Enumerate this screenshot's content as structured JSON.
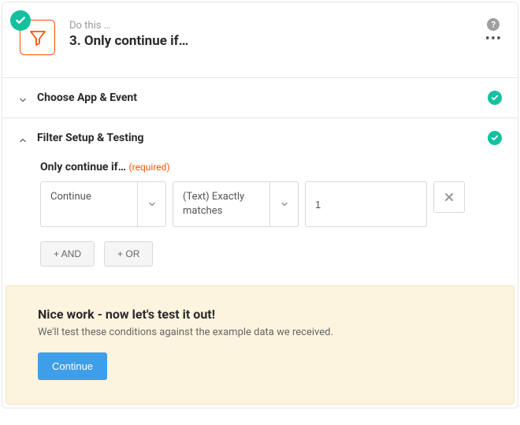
{
  "header": {
    "kicker": "Do this …",
    "title": "3. Only continue if…"
  },
  "sections": {
    "chooseApp": {
      "title": "Choose App & Event"
    },
    "filter": {
      "title": "Filter Setup & Testing",
      "fieldLabel": "Only continue if…",
      "required": "(required)",
      "row": {
        "field": "Continue",
        "condition": "(Text) Exactly matches",
        "value": "1"
      },
      "andBtn": "+ AND",
      "orBtn": "+ OR"
    }
  },
  "test": {
    "title": "Nice work - now let's test it out!",
    "desc": "We'll test these conditions against the example data we received.",
    "btn": "Continue"
  }
}
